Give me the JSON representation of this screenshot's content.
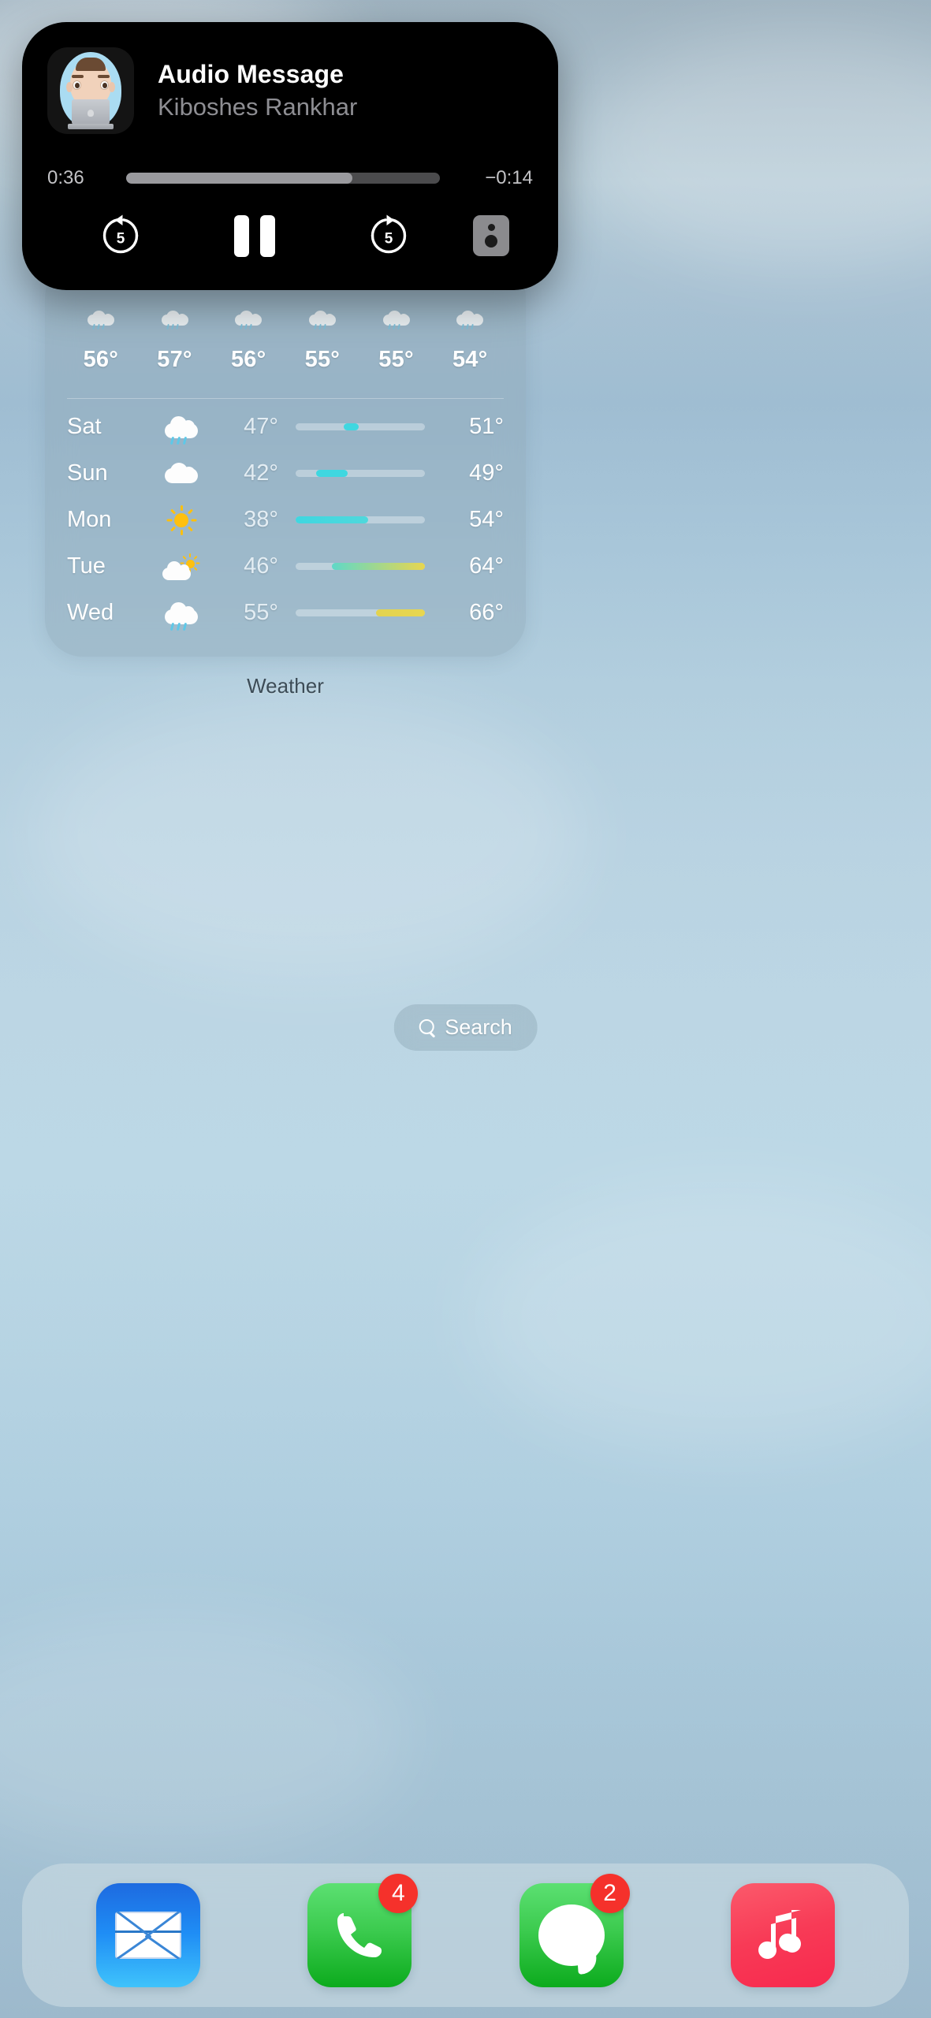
{
  "now_playing": {
    "title": "Audio Message",
    "subtitle": "Kiboshes Rankhar",
    "elapsed": "0:36",
    "remaining": "−0:14",
    "progress_percent": 72,
    "artwork_icon": "memoji-avatar",
    "controls": {
      "skip_back_label": "5",
      "skip_forward_label": "5",
      "play_pause_icon": "pause-icon",
      "airplay_icon": "airplay-speaker-icon"
    },
    "accent": "#9a9a9e"
  },
  "weather_widget": {
    "label": "Weather",
    "hourly": [
      {
        "temp": "56°",
        "icon": "cloud-rain-icon"
      },
      {
        "temp": "57°",
        "icon": "cloud-rain-icon"
      },
      {
        "temp": "56°",
        "icon": "cloud-rain-icon"
      },
      {
        "temp": "55°",
        "icon": "cloud-rain-icon"
      },
      {
        "temp": "55°",
        "icon": "cloud-rain-icon"
      },
      {
        "temp": "54°",
        "icon": "cloud-rain-icon"
      }
    ],
    "daily": [
      {
        "day": "Sat",
        "icon": "cloud-rain-icon",
        "low": "47°",
        "high": "51°",
        "bar_start_pct": 37,
        "bar_end_pct": 49,
        "bar_color_start": "#3fd7e0",
        "bar_color_end": "#3fd7e0"
      },
      {
        "day": "Sun",
        "icon": "cloud-icon",
        "low": "42°",
        "high": "49°",
        "bar_start_pct": 16,
        "bar_end_pct": 40,
        "bar_color_start": "#3fd7e0",
        "bar_color_end": "#3fd7e0"
      },
      {
        "day": "Mon",
        "icon": "sun-icon",
        "low": "38°",
        "high": "54°",
        "bar_start_pct": 0,
        "bar_end_pct": 56,
        "bar_color_start": "#3fd7e0",
        "bar_color_end": "#4fd8dc"
      },
      {
        "day": "Tue",
        "icon": "sun-behind-cloud-icon",
        "low": "46°",
        "high": "64°",
        "bar_start_pct": 28,
        "bar_end_pct": 100,
        "bar_color_start": "#5fd8c8",
        "bar_color_end": "#e8d64f"
      },
      {
        "day": "Wed",
        "icon": "cloud-rain-icon",
        "low": "55°",
        "high": "66°",
        "bar_start_pct": 62,
        "bar_end_pct": 100,
        "bar_color_start": "#e3d34f",
        "bar_color_end": "#e8d64f"
      }
    ]
  },
  "search": {
    "label": "Search",
    "icon": "search-icon"
  },
  "dock": {
    "apps": [
      {
        "name": "Mail",
        "icon": "mail-icon",
        "badge": ""
      },
      {
        "name": "Phone",
        "icon": "phone-icon",
        "badge": "4"
      },
      {
        "name": "Messages",
        "icon": "messages-icon",
        "badge": "2"
      },
      {
        "name": "Music",
        "icon": "music-icon",
        "badge": ""
      }
    ]
  }
}
